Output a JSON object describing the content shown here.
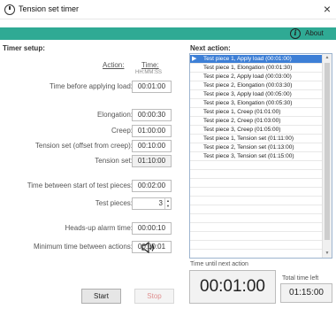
{
  "window": {
    "title": "Tension set timer",
    "close_label": "×"
  },
  "toolbar": {
    "about_label": "About"
  },
  "setup": {
    "heading": "Timer setup:",
    "col_action": "Action:",
    "col_time": "Time:",
    "col_time_format": "HH:MM:SS",
    "before_load": {
      "label": "Time before applying load:",
      "value": "00:01:00"
    },
    "elongation": {
      "label": "Elongation:",
      "value": "00:00:30"
    },
    "creep": {
      "label": "Creep:",
      "value": "01:00:00"
    },
    "tension_offset": {
      "label": "Tension set (offset from creep):",
      "value": "00:10:00"
    },
    "tension_set": {
      "label": "Tension set:",
      "value": "01:10:00"
    },
    "between_pieces": {
      "label": "Time between start of test pieces:",
      "value": "00:02:00"
    },
    "test_pieces": {
      "label": "Test pieces:",
      "value": "3"
    },
    "alarm_time": {
      "label": "Heads-up alarm time:",
      "value": "00:00:10"
    },
    "min_between": {
      "label": "Minimum time between actions:",
      "value": "00:00:01"
    }
  },
  "buttons": {
    "start": "Start",
    "stop": "Stop"
  },
  "next": {
    "heading": "Next action:",
    "items": [
      "Test piece 1, Apply load (00:01:00)",
      "Test piece 1, Elongation (00:01:30)",
      "Test piece 2, Apply load (00:03:00)",
      "Test piece 2, Elongation (00:03:30)",
      "Test piece 3, Apply load (00:05:00)",
      "Test piece 3, Elongation (00:05:30)",
      "Test piece 1, Creep (01:01:00)",
      "Test piece 2, Creep (01:03:00)",
      "Test piece 3, Creep (01:05:00)",
      "Test piece 1, Tension set (01:11:00)",
      "Test piece 2, Tension set (01:13:00)",
      "Test piece 3, Tension set (01:15:00)"
    ],
    "selected_index": 0
  },
  "status": {
    "until_label": "Time until next action",
    "until_value": "00:01:00",
    "total_label": "Total time left",
    "total_value": "01:15:00"
  }
}
